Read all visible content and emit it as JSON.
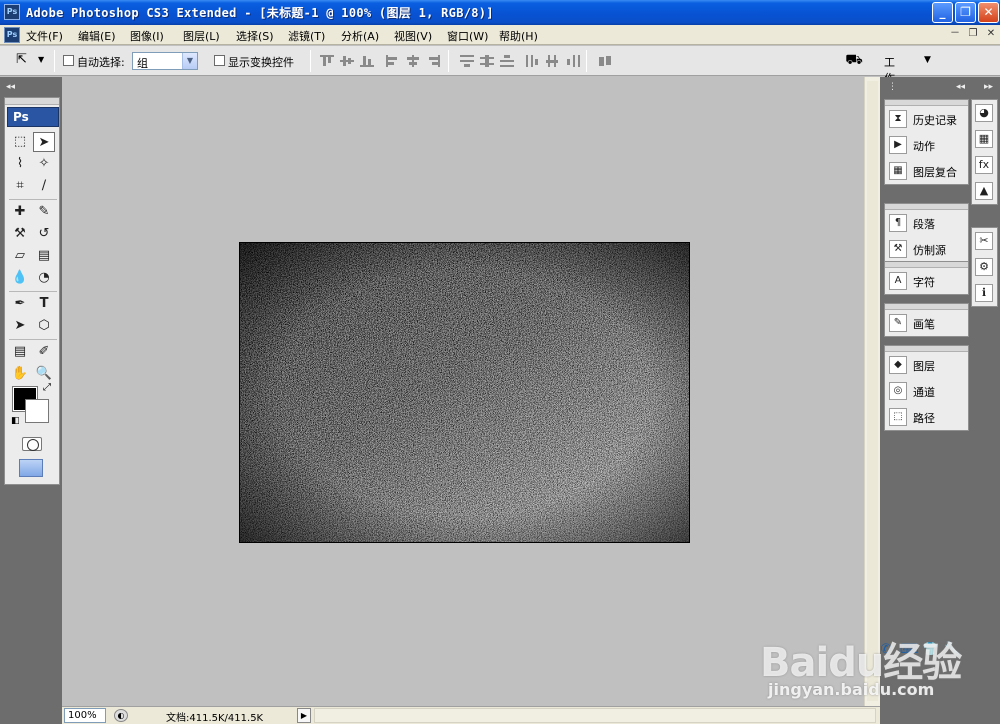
{
  "window": {
    "app_icon": "Ps",
    "title": "Adobe Photoshop CS3 Extended - [未标题-1 @ 100% (图层 1, RGB/8)]",
    "minimize_icon": "minimize-icon",
    "maximize_icon": "restore-icon",
    "close_icon": "close-icon"
  },
  "menubar": {
    "doc_icon": "Ps",
    "items": [
      {
        "label": "文件(F)"
      },
      {
        "label": "编辑(E)"
      },
      {
        "label": "图像(I)"
      },
      {
        "label": "图层(L)"
      },
      {
        "label": "选择(S)"
      },
      {
        "label": "滤镜(T)"
      },
      {
        "label": "分析(A)"
      },
      {
        "label": "视图(V)"
      },
      {
        "label": "窗口(W)"
      },
      {
        "label": "帮助(H)"
      }
    ],
    "mdi_minimize": "－",
    "mdi_restore": "❐",
    "mdi_close": "✕"
  },
  "options": {
    "auto_select_label": "自动选择:",
    "auto_select_value": "组",
    "show_transform_label": "显示变换控件",
    "workspace_label": "工作区"
  },
  "toolbox": {
    "logo": "Ps",
    "type_tool": "T"
  },
  "canvas": {
    "content": "gradient-noise",
    "colors": {
      "dark": "#000000",
      "light": "#ffffff"
    }
  },
  "status": {
    "zoom": "100%",
    "doc_info": "文档:411.5K/411.5K"
  },
  "panels": {
    "group1": [
      {
        "label": "历史记录",
        "icon": "history-icon"
      },
      {
        "label": "动作",
        "icon": "actions-icon"
      },
      {
        "label": "图层复合",
        "icon": "layer-comps-icon"
      }
    ],
    "group2": [
      {
        "label": "段落",
        "icon": "paragraph-icon"
      },
      {
        "label": "仿制源",
        "icon": "clone-source-icon"
      }
    ],
    "group3": [
      {
        "label": "字符",
        "icon": "character-icon"
      }
    ],
    "group4": [
      {
        "label": "画笔",
        "icon": "brushes-icon"
      }
    ],
    "group5": [
      {
        "label": "图层",
        "icon": "layers-icon"
      },
      {
        "label": "通道",
        "icon": "channels-icon"
      },
      {
        "label": "路径",
        "icon": "paths-icon"
      }
    ]
  },
  "watermark": {
    "brand": "Baidu经验",
    "url": "jingyan.baidu.com"
  }
}
